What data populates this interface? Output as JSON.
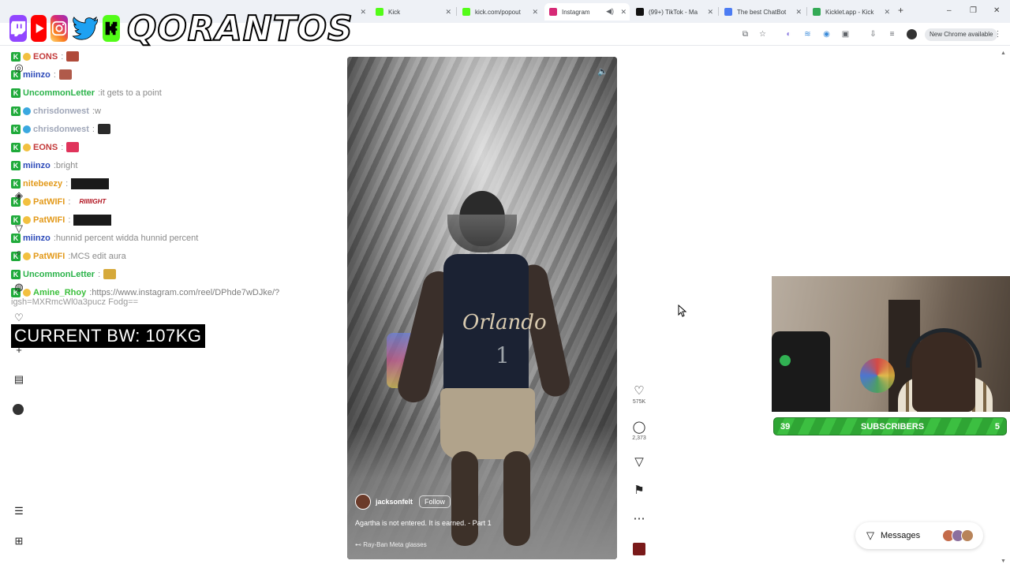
{
  "browser": {
    "tabs": [
      {
        "label": "",
        "color": "#9aa0a6"
      },
      {
        "label": "Kick",
        "color": "#53fc18"
      },
      {
        "label": "kick.com/popout",
        "color": "#53fc18"
      },
      {
        "label": "Instagram",
        "color": "#d62976"
      },
      {
        "label": "(99+) TikTok - Ma",
        "color": "#111111"
      },
      {
        "label": "The best ChatBot",
        "color": "#4c7cf3"
      },
      {
        "label": "Kicklet.app - Kick",
        "color": "#33aa55"
      }
    ],
    "new_tab": "+",
    "window_controls": [
      "–",
      "❐",
      "✕"
    ],
    "new_chrome": "New Chrome available"
  },
  "overlay": {
    "brand": "QORANTOS"
  },
  "chat": {
    "messages": [
      {
        "user": "EONS",
        "color": "#c33a3a",
        "text": "",
        "emote": "#b04a3a",
        "badge_emoji": "#f2c040"
      },
      {
        "user": "miinzo",
        "color": "#2a48b8",
        "text": "",
        "emote": "#b05a4a",
        "badge_emoji": ""
      },
      {
        "user": "UncommonLetter",
        "color": "#2bb34a",
        "text": "it gets to a point",
        "emote": "",
        "badge_emoji": ""
      },
      {
        "user": "chrisdonwest",
        "color": "#9fa6b8",
        "text": "w",
        "emote": "",
        "badge_emoji": "#3aa8e0"
      },
      {
        "user": "chrisdonwest",
        "color": "#9fa6b8",
        "text": "",
        "emote": "#2a2a2a",
        "badge_emoji": "#3aa8e0"
      },
      {
        "user": "EONS",
        "color": "#c33a3a",
        "text": "",
        "emote": "#e0345b",
        "badge_emoji": "#f2c040"
      },
      {
        "user": "miinzo",
        "color": "#2a48b8",
        "text": "bright",
        "emote": "",
        "badge_emoji": ""
      },
      {
        "user": "nitebeezy",
        "color": "#e39a1b",
        "text": "",
        "img": "#1a1a1a",
        "badge_emoji": ""
      },
      {
        "user": "PatWIFI",
        "color": "#e39a1b",
        "text": "",
        "img_text": "RIIIIIGHT",
        "badge_emoji": "#f2c040"
      },
      {
        "user": "PatWIFI",
        "color": "#e39a1b",
        "text": "",
        "img": "#1a1a1a",
        "badge_emoji": "#f2c040"
      },
      {
        "user": "miinzo",
        "color": "#2a48b8",
        "text": "hunnid percent widda hunnid percent",
        "emote": "",
        "badge_emoji": ""
      },
      {
        "user": "PatWIFI",
        "color": "#e39a1b",
        "text": "MCS edit aura",
        "emote": "",
        "badge_emoji": "#f2c040"
      },
      {
        "user": "UncommonLetter",
        "color": "#2bb34a",
        "text": "",
        "emote": "#d6a93a",
        "badge_emoji": ""
      },
      {
        "user": "Amine_Rhoy",
        "color": "#3bbf3b",
        "text": "https://www.instagram.com/reel/DPhde7wDJke/?",
        "emote": "",
        "badge_emoji": "#f2c040"
      }
    ],
    "link_continuation": "igsh=MXRmcWl0a3pucz Fodg==",
    "bw_label": "CURRENT BW: 107KG"
  },
  "reel": {
    "username": "jacksonfelt",
    "follow_label": "Follow",
    "caption": "Agartha is not entered. It is earned. - Part 1",
    "glasses": "Ray-Ban Meta glasses",
    "jersey_text": "Orlando",
    "jersey_number": "1",
    "likes": "575K",
    "comments": "2,373"
  },
  "stream": {
    "subs_left": "39",
    "subs_label": "SUBSCRIBERS",
    "subs_right": "5"
  },
  "messages_bar": {
    "label": "Messages"
  }
}
